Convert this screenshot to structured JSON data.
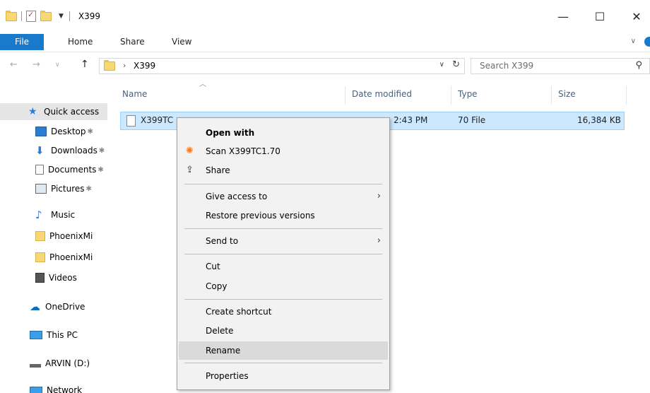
{
  "title_bar": {
    "title": "X399",
    "minimize_glyph": "—",
    "maximize_glyph": "☐",
    "close_glyph": "✕"
  },
  "ribbon": {
    "tabs": [
      "File",
      "Home",
      "Share",
      "View"
    ],
    "accent": "#1979ca"
  },
  "address": {
    "crumb_sep": "›",
    "path": "X399",
    "dropdown_glyph": "∨",
    "refresh_glyph": "↻"
  },
  "search": {
    "placeholder": "Search X399"
  },
  "nav_pane": {
    "items": [
      {
        "label": "Quick access",
        "icon": "star-icon"
      },
      {
        "label": "Desktop",
        "icon": "desktop-icon"
      },
      {
        "label": "Downloads",
        "icon": "download-icon"
      },
      {
        "label": "Documents",
        "icon": "documents-icon"
      },
      {
        "label": "Pictures",
        "icon": "pictures-icon"
      },
      {
        "label": "Music",
        "icon": "music-icon"
      },
      {
        "label": "PhoenixMi",
        "icon": "folder-icon"
      },
      {
        "label": "PhoenixMi",
        "icon": "folder-icon"
      },
      {
        "label": "Videos",
        "icon": "videos-icon"
      },
      {
        "label": "OneDrive",
        "icon": "cloud-icon"
      },
      {
        "label": "This PC",
        "icon": "computer-icon"
      },
      {
        "label": "ARVIN (D:)",
        "icon": "drive-icon"
      },
      {
        "label": "Network",
        "icon": "network-icon"
      }
    ]
  },
  "columns": [
    "Name",
    "Date modified",
    "Type",
    "Size"
  ],
  "file_row": {
    "name": "X399TC",
    "date": "2:43 PM",
    "type": "70 File",
    "size": "16,384 KB"
  },
  "context_menu": {
    "items": [
      {
        "label": "Open with",
        "bold": true
      },
      {
        "label": "Scan X399TC1.70",
        "icon": "antivirus-icon"
      },
      {
        "label": "Share",
        "icon": "share-icon"
      },
      {
        "label": "Give access to",
        "submenu": true
      },
      {
        "label": "Restore previous versions"
      },
      {
        "label": "Send to",
        "submenu": true
      },
      {
        "label": "Cut"
      },
      {
        "label": "Copy"
      },
      {
        "label": "Create shortcut"
      },
      {
        "label": "Delete"
      },
      {
        "label": "Rename",
        "highlighted": true
      },
      {
        "label": "Properties"
      }
    ],
    "submenu_glyph": "›"
  }
}
